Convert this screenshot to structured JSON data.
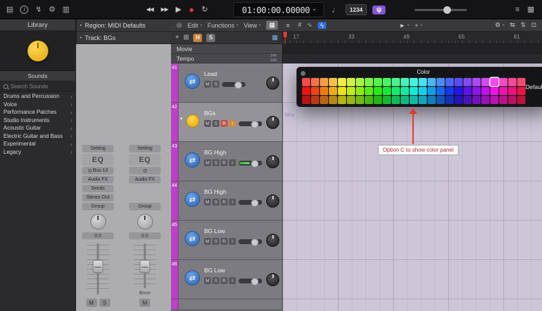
{
  "disclosure_icon": "▸",
  "track_icon_glyph": "⇄",
  "topbar": {
    "left_icons": [
      "▤",
      "i",
      "↯",
      "⚙",
      "▥"
    ],
    "transport": {
      "rewind": "◀◀",
      "forward": "▶▶",
      "play": "▶",
      "record": "●",
      "cycle": "↻"
    },
    "lcd": {
      "time": "01:00:00.00000",
      "chevron": "▾"
    },
    "metronome_icon": "♩",
    "count_in_label": "1234",
    "tuner_icon": "ψ",
    "right_icons": [
      "≡",
      "▦"
    ]
  },
  "library": {
    "title": "Library",
    "sounds_header": "Sounds",
    "search_placeholder": "Search Sounds",
    "items": [
      "Drums and Percussion",
      "Voice",
      "Performance Patches",
      "Studio Instruments",
      "Acoustic Guitar",
      "Electric Guitar and Bass",
      "Experimental",
      "Legacy"
    ]
  },
  "inspector": {
    "region_header": "Region: MIDI Defaults",
    "track_header": "Track: BGs",
    "strip_left": {
      "setting": "Setting",
      "eq": "EQ",
      "input": "Bus 13",
      "audio_fx": "Audio FX",
      "sends": "Sends",
      "output": "Stereo Out",
      "group": "Group",
      "gain": "0.0",
      "mute": "M",
      "solo": "S"
    },
    "strip_right": {
      "setting": "Setting",
      "eq": "EQ",
      "audio_fx": "Audio FX",
      "group": "Group",
      "gain": "0.0",
      "bounce": "Bnce",
      "mute": "M"
    }
  },
  "track_toolbar": {
    "catch_icon": "◎",
    "menus": [
      "Edit",
      "Functions",
      "View"
    ],
    "chevron": "▾",
    "view_icons": [
      "▦",
      "≡"
    ],
    "extra_icons": [
      "#",
      "∿"
    ],
    "flex_icon": "ϟ",
    "pointer_tool": "►",
    "command_tool": "+",
    "gear_icon": "⚙",
    "right_icons": [
      "⇆",
      "⇅",
      "⊡"
    ]
  },
  "track_header_toolbar": {
    "add": "+",
    "dup_icon": "⊞",
    "hide": "H",
    "solo": "S",
    "sort_icon": "▦"
  },
  "global_tracks": {
    "movie": "Movie",
    "tempo": "Tempo",
    "tempo_max": "140",
    "tempo_min": "100"
  },
  "ruler": {
    "marks": [
      "17",
      "33",
      "49",
      "65",
      "81"
    ]
  },
  "tracks": [
    {
      "num": "41",
      "name": "Lead",
      "icon": "blue",
      "buttons": [
        "M",
        "S"
      ],
      "selected": false
    },
    {
      "num": "42",
      "name": "BGs",
      "icon": "yellow",
      "disclosure": true,
      "buttons": [
        "M",
        "S",
        "R",
        "I"
      ],
      "selected": true
    },
    {
      "num": "43",
      "name": "BG High",
      "icon": "blue",
      "buttons": [
        "M",
        "S",
        "R",
        "I"
      ],
      "meter": true,
      "selected": false
    },
    {
      "num": "44",
      "name": "BG High",
      "icon": "blue",
      "buttons": [
        "M",
        "S",
        "R",
        "I"
      ],
      "selected": false
    },
    {
      "num": "45",
      "name": "BG Low",
      "icon": "blue",
      "buttons": [
        "M",
        "S",
        "R",
        "I"
      ],
      "selected": false
    },
    {
      "num": "46",
      "name": "BG Low",
      "icon": "blue",
      "buttons": [
        "M",
        "S",
        "R",
        "I"
      ],
      "selected": false
    }
  ],
  "workspace": {
    "region_label": "BGs"
  },
  "color_panel": {
    "title": "Color",
    "default_label": "Default",
    "hues": [
      0,
      14,
      29,
      43,
      58,
      72,
      86,
      101,
      115,
      130,
      144,
      158,
      173,
      187,
      202,
      216,
      230,
      245,
      259,
      274,
      288,
      302,
      317,
      331,
      346
    ],
    "levels": [
      {
        "s": 86,
        "l": 62
      },
      {
        "s": 84,
        "l": 50
      },
      {
        "s": 80,
        "l": 40
      }
    ],
    "selected": {
      "row": 0,
      "col": 21
    }
  },
  "annotation": {
    "text": "Option C to show color panel"
  }
}
